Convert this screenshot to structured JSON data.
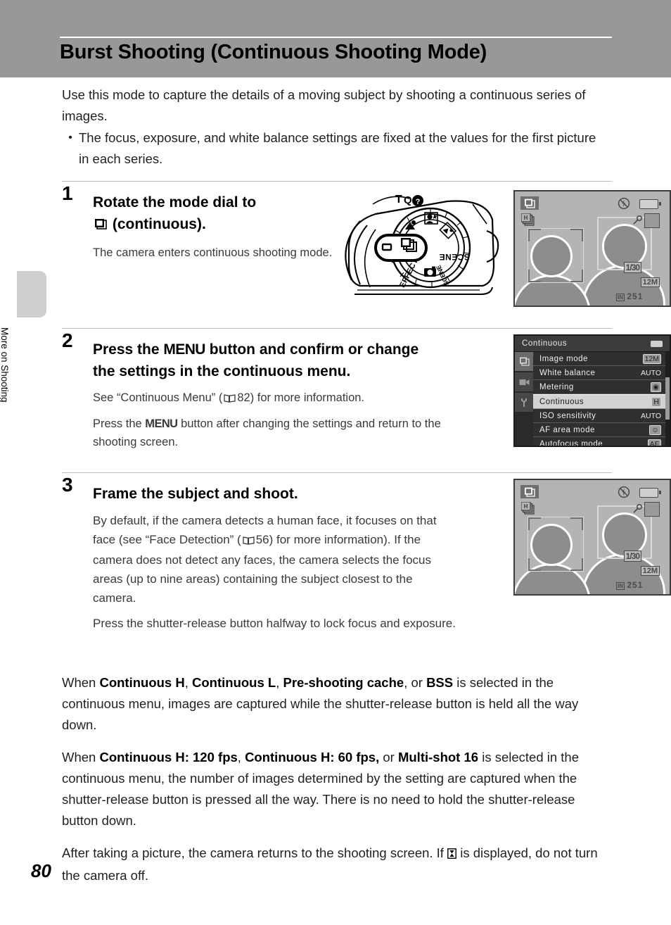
{
  "header": {
    "title": "Burst Shooting (Continuous Shooting Mode)"
  },
  "sidebar": {
    "tab_label": "More on Shooting"
  },
  "footer": {
    "page_number": "80"
  },
  "intro": {
    "paragraph": "Use this mode to capture the details of a moving subject by shooting a continuous series of images.",
    "bullet": "The focus, exposure, and white balance settings are fixed at the values for the first picture in each series.",
    "bullet_marker": "•"
  },
  "steps": [
    {
      "number": "1",
      "title_part1": "Rotate the mode dial to",
      "title_icon": "continuous-mode-icon",
      "title_part2": "(continuous).",
      "body": "The camera enters continuous shooting mode."
    },
    {
      "number": "2",
      "title_part1": "Press the",
      "title_menu_word": "MENU",
      "title_part2": "button and confirm or change the settings in the continuous menu.",
      "body1_pre": "See “Continuous Menu” (",
      "body1_page": "82",
      "body1_post": ") for more information.",
      "body2_pre": "Press the",
      "body2_menu_word": "MENU",
      "body2_post": "button after changing the settings and return to the shooting screen."
    },
    {
      "number": "3",
      "title": "Frame the subject and shoot.",
      "body1_pre": "By default, if the camera detects a human face, it focuses on that face (see “Face Detection” (",
      "body1_page": "56",
      "body1_post": ") for more information). If the camera does not detect any faces, the camera selects the focus areas (up to nine areas) containing the subject closest to the camera.",
      "body2": "Press the shutter-release button halfway to lock focus and exposure."
    }
  ],
  "notes": [
    {
      "id": "note-continuous-modes",
      "pre": "When ",
      "bold1": "Continuous H",
      "sep1": ", ",
      "bold2": "Continuous L",
      "sep2": ", ",
      "bold3": "Pre-shooting cache",
      "sep3": ", or ",
      "bold4": "BSS",
      "post": " is selected in the continuous menu, images are captured while the shutter-release button is held all the way down."
    },
    {
      "id": "note-fps-modes",
      "pre": "When ",
      "bold1": "Continuous H: 120 fps",
      "sep1": ", ",
      "bold2": "Continuous H: 60 fps,",
      "sep2": " or ",
      "bold3": "Multi-shot 16",
      "post": " is selected in the continuous menu, the number of images determined by the setting are captured when the shutter-release button is pressed all the way. There is no need to hold the shutter-release button down."
    },
    {
      "id": "note-hourglass",
      "pre": "After taking a picture, the camera returns to the shooting screen. If ",
      "icon": "hourglass-icon",
      "post": " is displayed, do not turn the camera off."
    }
  ],
  "camera_figure": {
    "name": "camera-mode-dial-illustration",
    "labels": {
      "scene_right": "SCENE",
      "scene_bottom": "SCENE",
      "effects": "EFFECTS",
      "help": "?"
    },
    "highlighted_mode": "continuous"
  },
  "lcd_screens": [
    {
      "name": "lcd-shooting-screen-step1",
      "mode_badge": "continuous-mode-icon",
      "sub_badge": "continuous-h-icon",
      "flash_icon": "flash-off-icon",
      "battery_icon": "battery-icon",
      "macro_icon": "macro-icon",
      "vr_icon": "vibration-reduction-icon",
      "shutter_speed": "1/30",
      "image_size": "12M",
      "memory_label": "IN",
      "shots_remaining": "251"
    },
    {
      "name": "lcd-shooting-screen-step3",
      "mode_badge": "continuous-mode-icon",
      "sub_badge": "continuous-h-icon",
      "flash_icon": "flash-off-icon",
      "battery_icon": "battery-icon",
      "macro_icon": "macro-icon",
      "vr_icon": "vibration-reduction-icon",
      "shutter_speed": "1/30",
      "image_size": "12M",
      "memory_label": "IN",
      "shots_remaining": "251"
    }
  ],
  "menu_screen": {
    "name": "continuous-menu-screen",
    "title": "Continuous",
    "battery_icon": "battery-icon",
    "tabs": [
      {
        "name": "tab-shooting",
        "icon": "continuous-mode-icon",
        "active": true
      },
      {
        "name": "tab-movie",
        "icon": "movie-camera-icon",
        "active": false
      },
      {
        "name": "tab-setup",
        "icon": "wrench-icon",
        "active": false
      }
    ],
    "items": [
      {
        "label": "Image mode",
        "value": "12M",
        "value_type": "chip",
        "selected": false
      },
      {
        "label": "White balance",
        "value": "AUTO",
        "value_type": "text",
        "selected": false
      },
      {
        "label": "Metering",
        "value": "◉",
        "value_type": "chip",
        "selected": false
      },
      {
        "label": "Continuous",
        "value": "H",
        "value_type": "chip",
        "selected": true
      },
      {
        "label": "ISO sensitivity",
        "value": "AUTO",
        "value_type": "text",
        "selected": false
      },
      {
        "label": "AF area mode",
        "value": "☺",
        "value_type": "chip",
        "selected": false
      },
      {
        "label": "Autofocus mode",
        "value": "AF",
        "value_type": "chip",
        "selected": false
      }
    ]
  },
  "colors": {
    "header_bg": "#989898",
    "rule": "#bdbdbd",
    "lcd_bg": "#b4b4b4",
    "menu_bg": "#2f2f2f",
    "menu_selected": "#d2d2d2",
    "side_tab": "#cfcfcf"
  }
}
